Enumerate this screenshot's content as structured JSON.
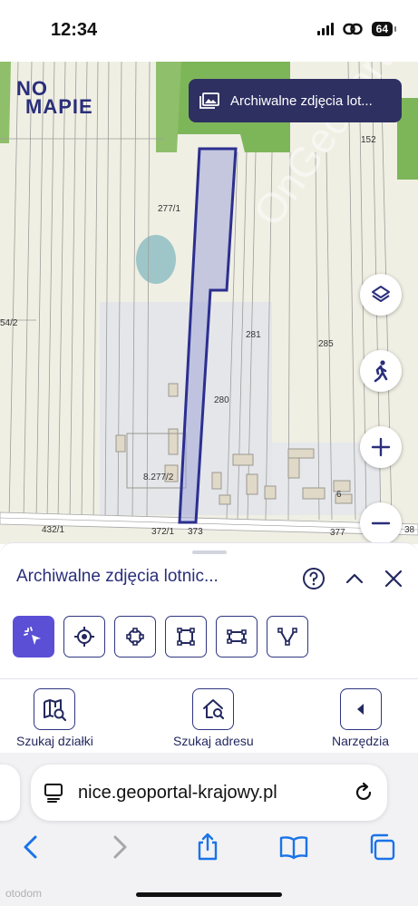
{
  "status_bar": {
    "time": "12:34",
    "battery": "64"
  },
  "map": {
    "logo_line1": "NO",
    "logo_line2": "MAPIE",
    "archive_chip_label": "Archiwalne zdjęcia lot...",
    "watermark": "OnGeoportal",
    "parcel_labels": [
      "152",
      "277/1",
      "54/2",
      "281",
      "285",
      "280",
      "8.277/2",
      "6",
      "432/1",
      "372/1",
      "373",
      "377",
      "38"
    ],
    "controls": [
      "layers-icon",
      "walk-icon",
      "zoom-in-icon",
      "zoom-out-icon"
    ],
    "parcel_highlight_color": "#2c2f8f"
  },
  "panel": {
    "title": "Archiwalne zdjęcia lotnic...",
    "tools": [
      "select-icon",
      "locate-icon",
      "area-icon",
      "rectangle-icon",
      "measure-rect-icon",
      "polyline-icon"
    ]
  },
  "nav": {
    "items": [
      {
        "label": "Szukaj działki",
        "icon": "map-search-icon"
      },
      {
        "label": "Szukaj adresu",
        "icon": "home-search-icon"
      },
      {
        "label": "Narzędzia",
        "icon": "chevron-left-icon"
      }
    ]
  },
  "browser": {
    "url": "nice.geoportal-krajowy.pl",
    "toolbar": [
      "back-icon",
      "forward-icon",
      "share-icon",
      "bookmarks-icon",
      "tabs-icon"
    ]
  },
  "footer_watermark": "otodom",
  "colors": {
    "accent": "#5b4fd6",
    "brand": "#2a2f7a",
    "chip": "#2e3062"
  }
}
